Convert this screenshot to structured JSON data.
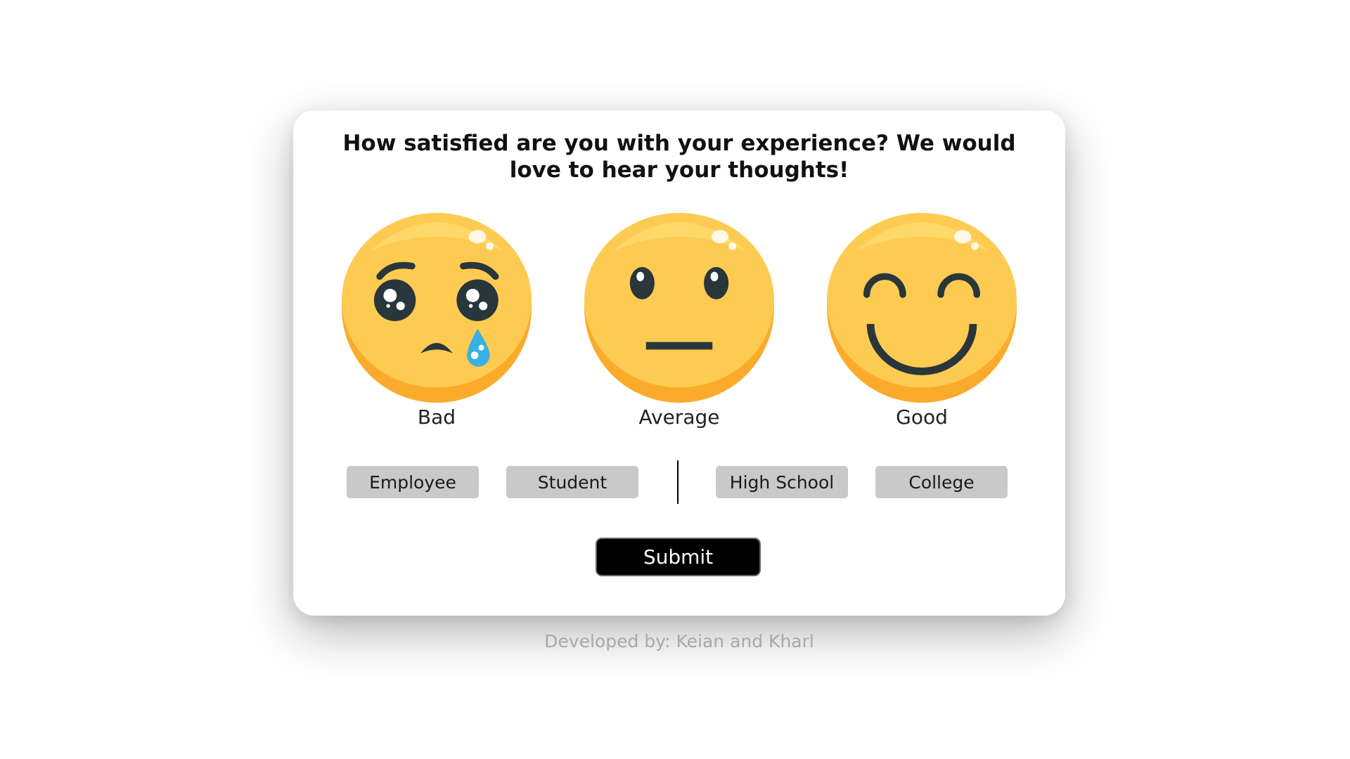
{
  "survey": {
    "question": "How satisfied are you with your experience? We would love to hear your thoughts!",
    "ratings": [
      {
        "label": "Bad",
        "icon": "crying-face-icon"
      },
      {
        "label": "Average",
        "icon": "neutral-face-icon"
      },
      {
        "label": "Good",
        "icon": "smiling-face-icon"
      }
    ],
    "roles": [
      {
        "label": "Employee"
      },
      {
        "label": "Student"
      }
    ],
    "levels": [
      {
        "label": "High School"
      },
      {
        "label": "College"
      }
    ],
    "submit_label": "Submit"
  },
  "footer": {
    "credit": "Developed by: Keian and Kharl"
  },
  "colors": {
    "emoji_face": "#fdcb52",
    "emoji_shade": "#fbab2c",
    "emoji_highlight": "#ffe47a",
    "emoji_features": "#29363b",
    "tear": "#38b0e5",
    "button_bg": "#c9c9c9",
    "submit_bg": "#000000",
    "footer_text": "#a8a8a8"
  }
}
